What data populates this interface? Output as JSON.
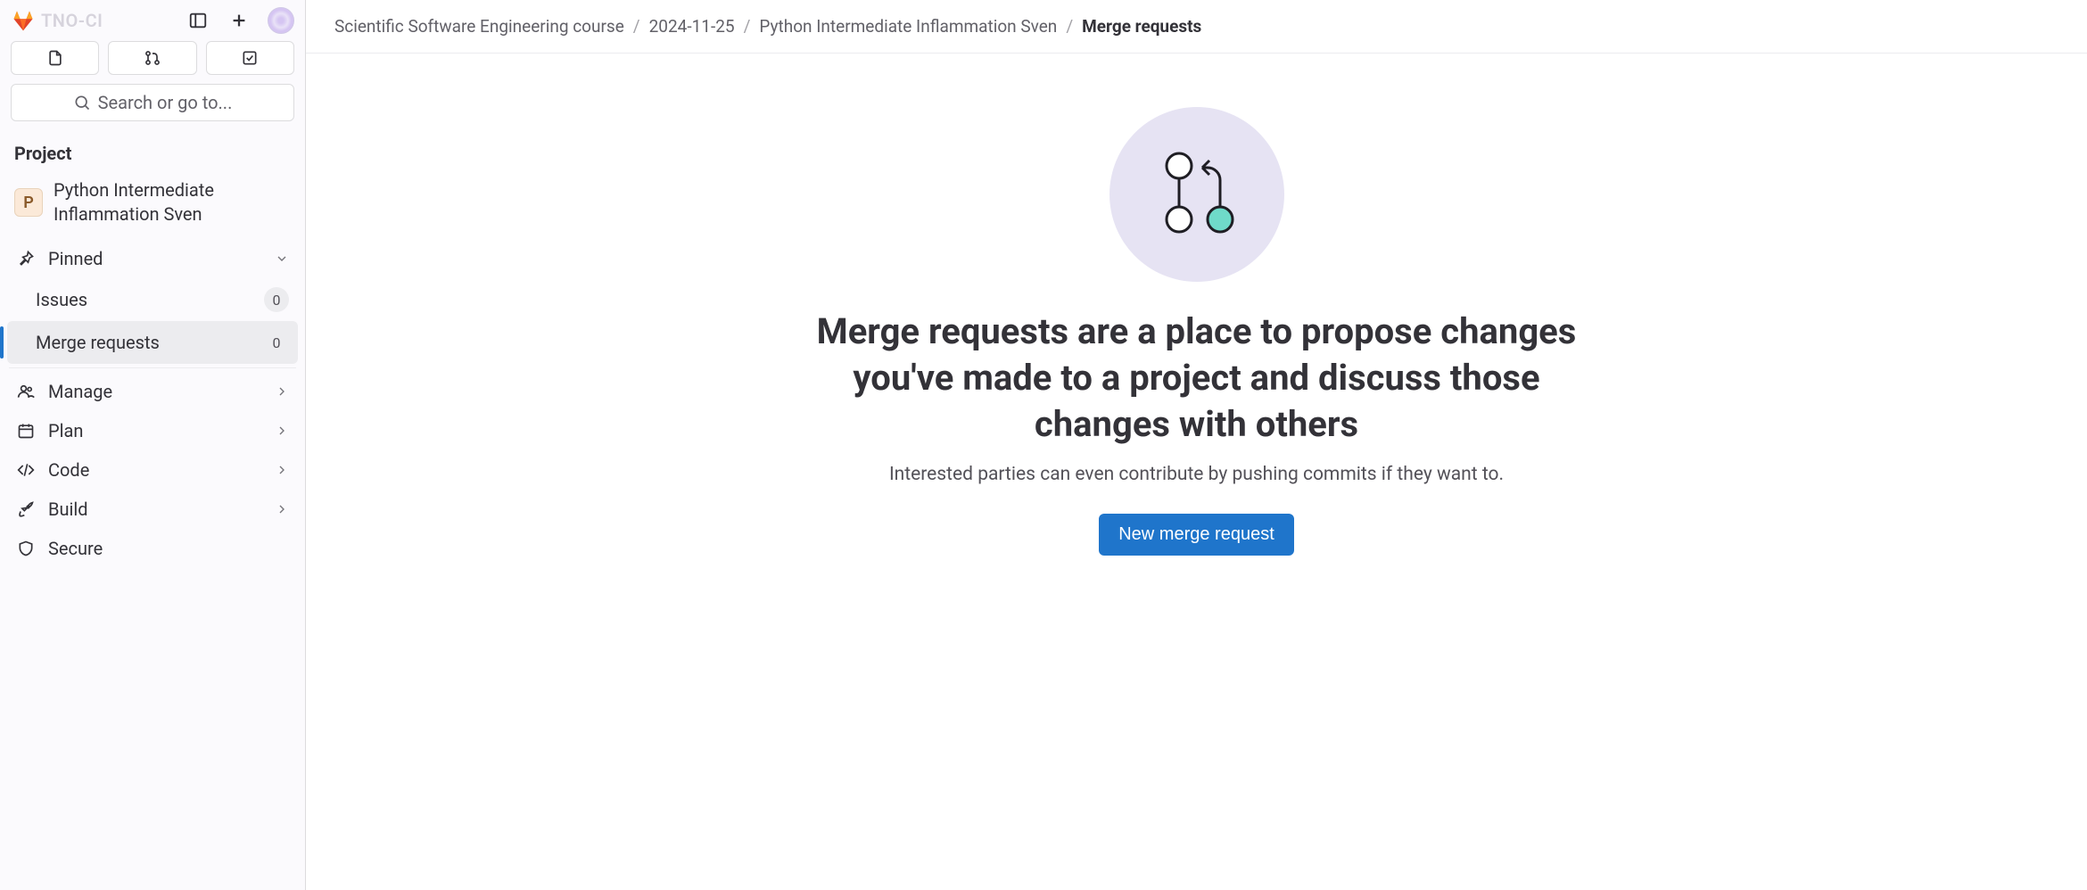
{
  "header": {
    "logo_text": "TNO-CI"
  },
  "search": {
    "placeholder": "Search or go to..."
  },
  "sidebar": {
    "section_label": "Project",
    "project_avatar_letter": "P",
    "project_name": "Python Intermediate Inflammation Sven",
    "pinned_label": "Pinned",
    "pinned_items": [
      {
        "label": "Issues",
        "count": "0"
      },
      {
        "label": "Merge requests",
        "count": "0"
      }
    ],
    "nav_items": [
      {
        "label": "Manage"
      },
      {
        "label": "Plan"
      },
      {
        "label": "Code"
      },
      {
        "label": "Build"
      },
      {
        "label": "Secure"
      }
    ]
  },
  "breadcrumbs": {
    "items": [
      "Scientific Software Engineering course",
      "2024-11-25",
      "Python Intermediate Inflammation Sven"
    ],
    "current": "Merge requests"
  },
  "empty_state": {
    "title": "Merge requests are a place to propose changes you've made to a project and discuss those changes with others",
    "description": "Interested parties can even contribute by pushing commits if they want to.",
    "button_label": "New merge request"
  }
}
